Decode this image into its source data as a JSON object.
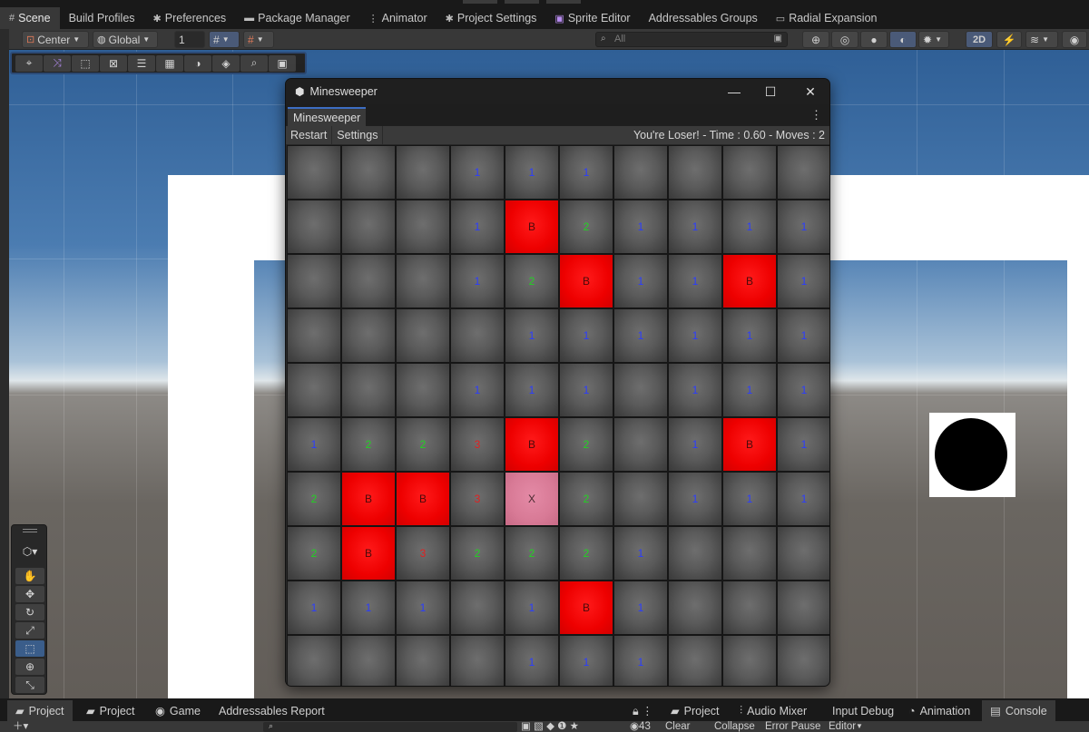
{
  "top_tabs": [
    {
      "label": "Scene",
      "icon": "grid-icon",
      "active": true
    },
    {
      "label": "Build Profiles",
      "icon": "",
      "active": false
    },
    {
      "label": "Preferences",
      "icon": "gear-icon",
      "active": false
    },
    {
      "label": "Package Manager",
      "icon": "package-icon",
      "active": false
    },
    {
      "label": "Animator",
      "icon": "animator-icon",
      "active": false
    },
    {
      "label": "Project Settings",
      "icon": "gear-icon",
      "active": false
    },
    {
      "label": "Sprite Editor",
      "icon": "sprite-editor-icon",
      "active": false
    },
    {
      "label": "Addressables Groups",
      "icon": "",
      "active": false
    },
    {
      "label": "Radial Expansion",
      "icon": "window-icon",
      "active": false
    }
  ],
  "toolbar": {
    "pivot": "Center",
    "space": "Global",
    "grid_size": "1",
    "search_placeholder": "All",
    "mode_2d": "2D"
  },
  "minesweeper": {
    "window_title": "Minesweeper",
    "tab_label": "Minesweeper",
    "restart_label": "Restart",
    "settings_label": "Settings",
    "status": "You're Loser! - Time : 0.60 - Moves : 2",
    "board": [
      [
        "",
        "",
        "",
        "1",
        "1",
        "1",
        "",
        "",
        "",
        ""
      ],
      [
        "",
        "",
        "",
        "1",
        "B",
        "2",
        "1",
        "1",
        "1",
        "1"
      ],
      [
        "",
        "",
        "",
        "1",
        "2",
        "B",
        "1",
        "1",
        "B",
        "1"
      ],
      [
        "",
        "",
        "",
        "",
        "1",
        "1",
        "1",
        "1",
        "1",
        "1"
      ],
      [
        "",
        "",
        "",
        "1",
        "1",
        "1",
        "",
        "1",
        "1",
        "1"
      ],
      [
        "1",
        "2",
        "2",
        "3",
        "B",
        "2",
        "",
        "1",
        "B",
        "1"
      ],
      [
        "2",
        "B",
        "B",
        "3",
        "X",
        "2",
        "",
        "1",
        "1",
        "1"
      ],
      [
        "2",
        "B",
        "3",
        "2",
        "2",
        "2",
        "1",
        "",
        "",
        ""
      ],
      [
        "1",
        "1",
        "1",
        "",
        "1",
        "B",
        "1",
        "",
        "",
        ""
      ],
      [
        "",
        "",
        "",
        "",
        "1",
        "1",
        "1",
        "",
        "",
        ""
      ]
    ]
  },
  "bottom_tabs": [
    {
      "label": "Project",
      "icon": "folder-icon",
      "active": true
    },
    {
      "label": "Project",
      "icon": "folder-icon",
      "active": false
    },
    {
      "label": "Game",
      "icon": "gamepad-icon",
      "active": false
    },
    {
      "label": "Addressables Report",
      "icon": "",
      "active": false
    },
    {
      "label": "Project",
      "icon": "folder-icon",
      "active": false
    },
    {
      "label": "Audio Mixer",
      "icon": "mixer-icon",
      "active": false
    },
    {
      "label": "Input Debug",
      "icon": "",
      "active": false
    },
    {
      "label": "Animation",
      "icon": "animation-icon",
      "active": false
    },
    {
      "label": "Console",
      "icon": "console-icon",
      "active": true
    }
  ],
  "bottom_bar": {
    "visible_count": "43",
    "clear_label": "Clear",
    "collapse_label": "Collapse",
    "error_pause_label": "Error Pause",
    "editor_label": "Editor"
  },
  "colors": {
    "bomb_cell": "#ee0000",
    "hit_cell": "#d87a96",
    "number_1": "#2a3cff",
    "number_2": "#22d022",
    "number_3": "#e02020",
    "accent": "#3d6ec4"
  }
}
